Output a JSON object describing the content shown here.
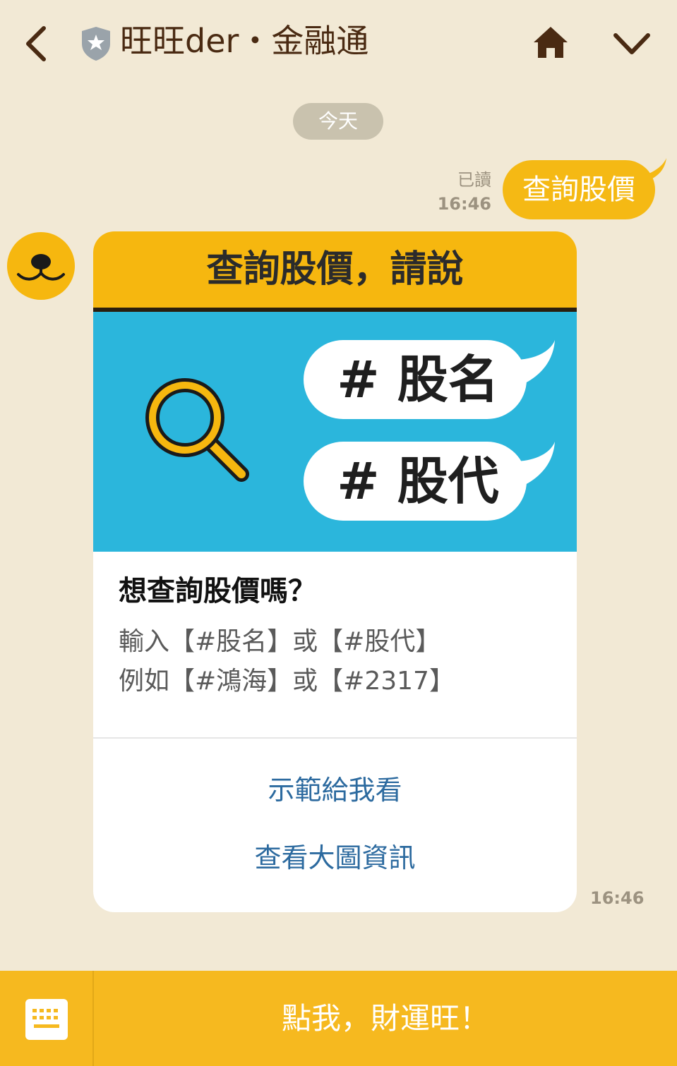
{
  "header": {
    "title": "旺旺der・金融通",
    "icons": {
      "back": "chevron-left-icon",
      "verified": "shield-star-icon",
      "home": "home-icon",
      "menu": "chevron-down-icon"
    }
  },
  "chat": {
    "date_label": "今天",
    "user_message": {
      "text": "查詢股價",
      "read_label": "已讀",
      "time": "16:46"
    },
    "bot_card": {
      "banner_title": "查詢股價，請說",
      "tags": [
        "# 股名",
        "# 股代"
      ],
      "heading": "想查詢股價嗎？",
      "lines": [
        "輸入【#股名】或【#股代】",
        "例如【#鴻海】或【#2317】"
      ],
      "actions": [
        "示範給我看",
        "查看大圖資訊"
      ],
      "time": "16:46"
    }
  },
  "bottom_bar": {
    "keyboard_icon": "keyboard-icon",
    "label": "點我，財運旺！"
  },
  "colors": {
    "background": "#f2e9d5",
    "accent": "#f6b70f",
    "banner_blue": "#2bb6dc",
    "link": "#2c6a9f",
    "title_brown": "#4a2a12"
  }
}
